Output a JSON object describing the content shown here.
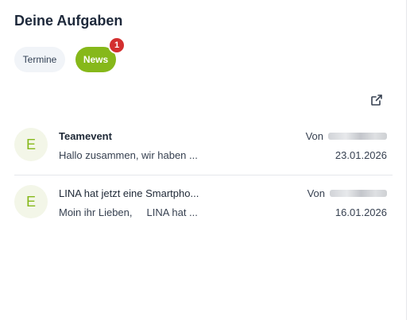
{
  "widget": {
    "title": "Deine Aufgaben"
  },
  "tabs": [
    {
      "label": "Termine",
      "active": false
    },
    {
      "label": "News",
      "active": true,
      "badge": "1"
    }
  ],
  "colors": {
    "accent": "#86b81a",
    "badge": "#d32f2f",
    "tab_inactive_bg": "#f1f4f8"
  },
  "external_link_icon": "external-link-icon",
  "news": [
    {
      "avatar": "E",
      "subject": "Teamevent",
      "subject_bold": true,
      "preview": "Hallo zusammen, wir haben ...",
      "from_label": "Von",
      "date": "23.01.2026"
    },
    {
      "avatar": "E",
      "subject": "LINA hat jetzt eine Smartpho...",
      "subject_bold": false,
      "preview": "Moin ihr Lieben,     LINA hat ...",
      "from_label": "Von",
      "date": "16.01.2026"
    }
  ]
}
